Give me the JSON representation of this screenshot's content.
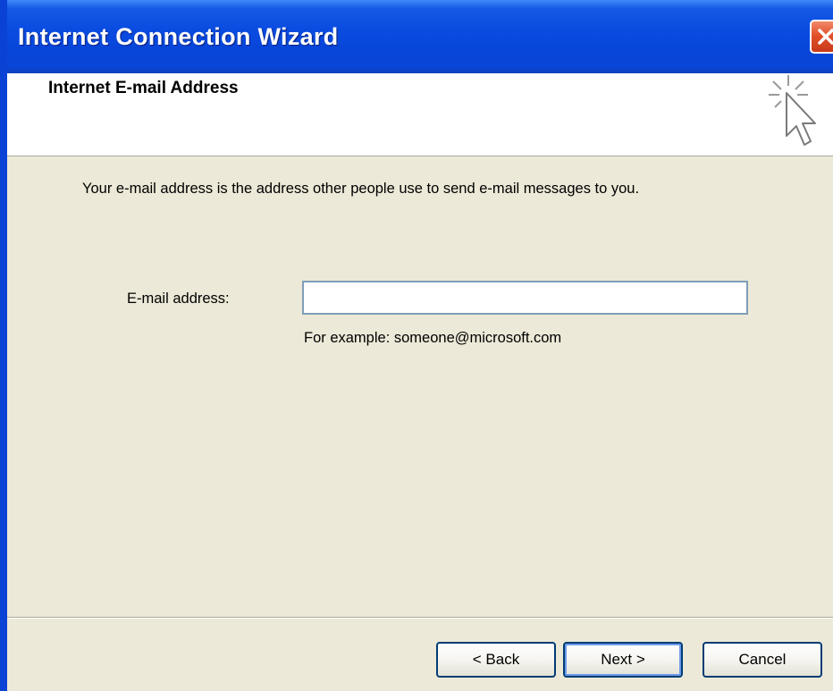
{
  "window": {
    "title": "Internet Connection Wizard"
  },
  "header": {
    "title": "Internet E-mail Address",
    "icon": "wizard-cursor-icon"
  },
  "body": {
    "intro": "Your e-mail address is the address other people use to send e-mail messages to you.",
    "email_label": "E-mail address:",
    "email_value": "",
    "example": "For example: someone@microsoft.com"
  },
  "buttons": {
    "back": "< Back",
    "next": "Next >",
    "cancel": "Cancel"
  },
  "colors": {
    "titlebar": "#0a4ce0",
    "close": "#e2512c",
    "dialog_bg": "#ece9d8"
  }
}
